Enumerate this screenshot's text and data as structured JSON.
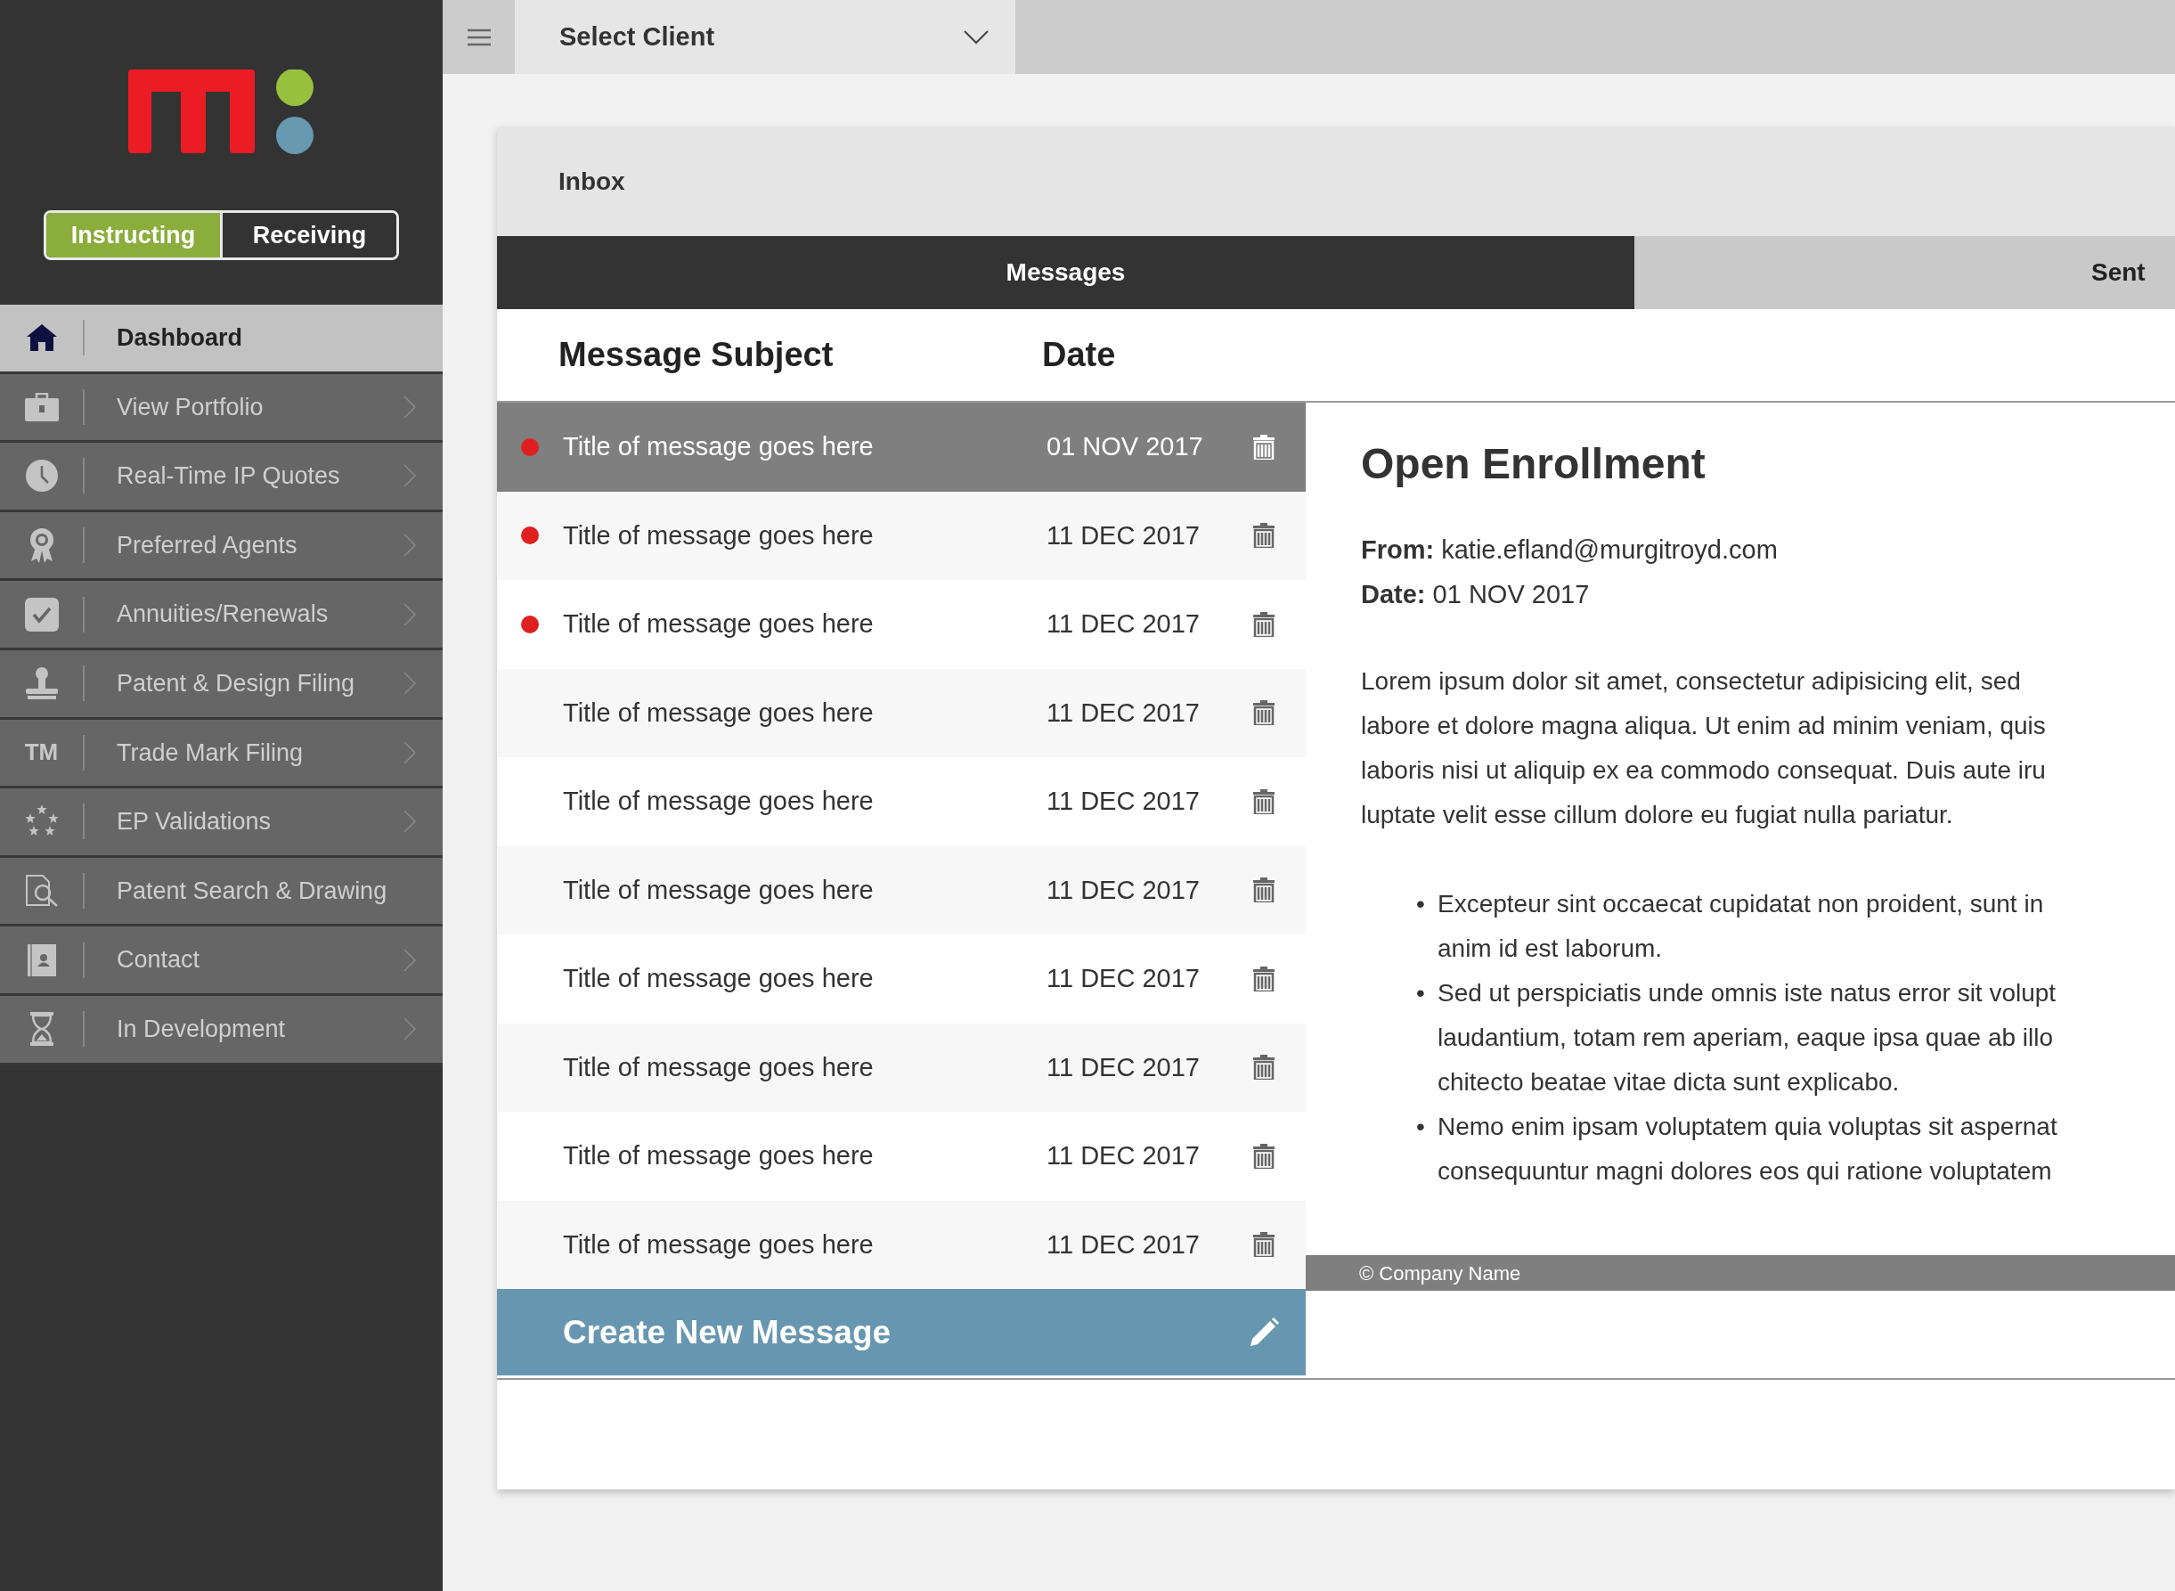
{
  "mode_toggle": [
    {
      "label": "Instructing",
      "selected": true
    },
    {
      "label": "Receiving",
      "selected": false
    }
  ],
  "sidebar": {
    "items": [
      {
        "label": "Dashboard",
        "kind": "home",
        "selected": true,
        "chevron": false
      },
      {
        "label": "View Portfolio",
        "kind": "briefcase",
        "selected": false,
        "chevron": true
      },
      {
        "label": "Real-Time IP Quotes",
        "kind": "clock",
        "selected": false,
        "chevron": true
      },
      {
        "label": "Preferred Agents",
        "kind": "award",
        "selected": false,
        "chevron": true
      },
      {
        "label": "Annuities/Renewals",
        "kind": "check",
        "selected": false,
        "chevron": true
      },
      {
        "label": "Patent & Design Filing",
        "kind": "stamp",
        "selected": false,
        "chevron": true
      },
      {
        "label": "Trade Mark Filing",
        "kind": "text",
        "icon_text": "TM",
        "selected": false,
        "chevron": true
      },
      {
        "label": "EP Validations",
        "kind": "stars",
        "selected": false,
        "chevron": true
      },
      {
        "label": "Patent Search & Drawing",
        "kind": "search-doc",
        "selected": false,
        "chevron": false
      },
      {
        "label": "Contact",
        "kind": "contact",
        "selected": false,
        "chevron": true
      },
      {
        "label": "In Development",
        "kind": "hourglass",
        "selected": false,
        "chevron": true
      }
    ]
  },
  "top_bar": {
    "client_select": {
      "label": "Select Client"
    }
  },
  "inbox": {
    "title": "Inbox",
    "tabs": [
      {
        "label": "Messages",
        "selected": true
      },
      {
        "label": "Sent",
        "selected": false
      }
    ],
    "columns": [
      "Message Subject",
      "Date"
    ],
    "messages": [
      {
        "subject": "Title of message goes here",
        "date": "01 NOV 2017",
        "unread": true,
        "selected": true
      },
      {
        "subject": "Title of message goes here",
        "date": "11 DEC 2017",
        "unread": true,
        "selected": false
      },
      {
        "subject": "Title of message goes here",
        "date": "11 DEC 2017",
        "unread": true,
        "selected": false
      },
      {
        "subject": "Title of message goes here",
        "date": "11 DEC 2017",
        "unread": false,
        "selected": false
      },
      {
        "subject": "Title of message goes here",
        "date": "11 DEC 2017",
        "unread": false,
        "selected": false
      },
      {
        "subject": "Title of message goes here",
        "date": "11 DEC 2017",
        "unread": false,
        "selected": false
      },
      {
        "subject": "Title of message goes here",
        "date": "11 DEC 2017",
        "unread": false,
        "selected": false
      },
      {
        "subject": "Title of message goes here",
        "date": "11 DEC 2017",
        "unread": false,
        "selected": false
      },
      {
        "subject": "Title of message goes here",
        "date": "11 DEC 2017",
        "unread": false,
        "selected": false
      },
      {
        "subject": "Title of message goes here",
        "date": "11 DEC 2017",
        "unread": false,
        "selected": false
      }
    ],
    "create_button": "Create New Message",
    "detail": {
      "title": "Open Enrollment",
      "meta": [
        {
          "label": "From:",
          "value": "katie.efland@murgitroyd.com"
        },
        {
          "label": "Date:",
          "value": "01 NOV 2017"
        }
      ],
      "body_lines": [
        "Lorem ipsum dolor sit amet, consectetur adipisicing elit, sed",
        "labore et dolore magna aliqua. Ut enim ad minim veniam, quis",
        "laboris nisi ut aliquip ex ea commodo consequat. Duis aute iru",
        "luptate velit esse cillum dolore eu fugiat nulla pariatur."
      ],
      "bullets": [
        {
          "marker": "•",
          "lines": [
            "Excepteur sint occaecat cupidatat non proident, sunt in",
            "anim id est laborum."
          ]
        },
        {
          "marker": "•",
          "lines": [
            "Sed ut perspiciatis unde omnis iste natus error sit volupt",
            "laudantium, totam rem aperiam, eaque ipsa quae ab illo",
            "chitecto beatae vitae dicta sunt explicabo."
          ]
        },
        {
          "marker": "•",
          "lines": [
            "Nemo enim ipsam voluptatem quia voluptas sit aspernat",
            "consequuntur magni dolores eos qui ratione voluptatem"
          ]
        }
      ],
      "footer": "© Company Name"
    }
  }
}
